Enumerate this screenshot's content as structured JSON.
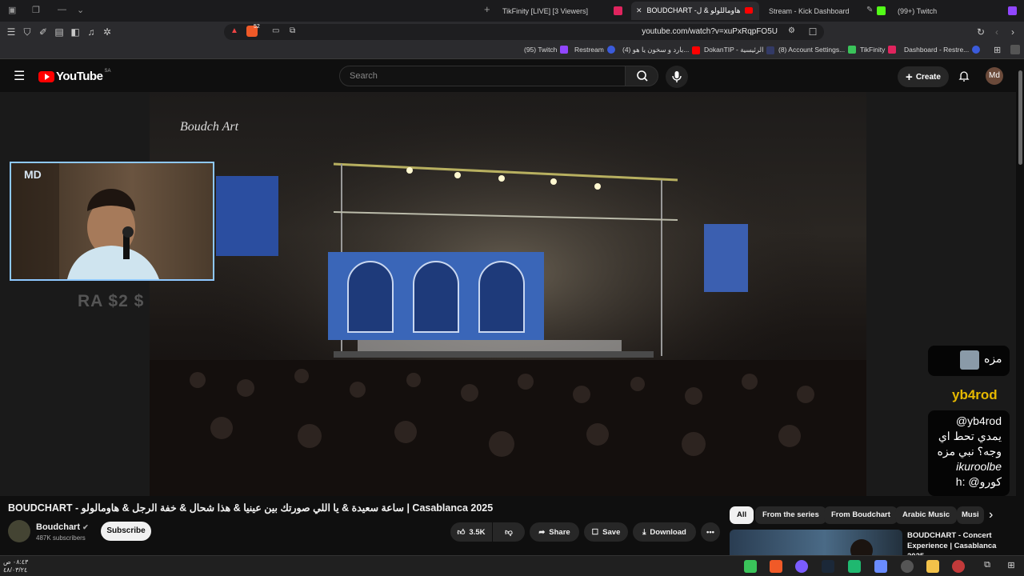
{
  "browser": {
    "tabs": [
      {
        "label": "TikFinity [LIVE] [3 Viewers]",
        "active": false
      },
      {
        "label": "BOUDCHART -هاوماللولو & ل",
        "active": true
      },
      {
        "label": "Stream - Kick Dashboard",
        "active": false
      },
      {
        "label": "(99+) Twitch",
        "active": false
      }
    ],
    "url": "youtube.com/watch?v=xuPxRqpFO5U",
    "shield_count": "52",
    "bookmarks": [
      "(95) Twitch",
      "Restream",
      "(4) بارد و سخون يا هو...",
      "DokanTIP - الرئيسية",
      "(8) Account Settings...",
      "TikFinity",
      "Dashboard - Restre..."
    ]
  },
  "youtube": {
    "logo_text": "YouTube",
    "country_code": "SA",
    "search_placeholder": "Search",
    "create_label": "Create",
    "avatar_initials": "Md"
  },
  "video": {
    "watermark": "Boudch Art",
    "cam_logo": "MD",
    "donation_text": "RA $2 $",
    "chat": {
      "top_message": "مزه",
      "username": "yb4rod",
      "message_lines": [
        "@yb4rod",
        "يمدي تحط اي",
        "وجه؟ نبي مزه",
        "ikuroolbe",
        "h: @كورو"
      ]
    }
  },
  "watch": {
    "title": "BOUDCHART - ساعة سعيدة & يا اللي صورتك بين عينيا & هذا شحال & خفة الرجل & هاومالولو | Casablanca 2025",
    "channel_name": "Boudchart",
    "subscribers": "487K subscribers",
    "subscribe_label": "Subscribe",
    "likes": "3.5K",
    "share_label": "Share",
    "save_label": "Save",
    "download_label": "Download"
  },
  "recommendations": {
    "chips": [
      "All",
      "From the series",
      "From Boudchart",
      "Arabic Music",
      "Musi"
    ],
    "first_title": "BOUDCHART - Concert Experience | Casablanca 2025"
  },
  "taskbar": {
    "time": "٠٨:٤٣ ص",
    "date": "٤٨/٠٣/٢٤"
  },
  "colors": {
    "yt_red": "#ff0000",
    "bg": "#0f0f0f",
    "chat_username": "#e6b800",
    "webcam_border": "#8ec8ff"
  }
}
